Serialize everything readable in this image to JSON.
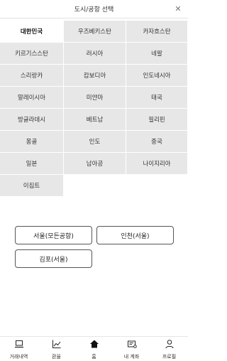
{
  "header": {
    "title": "도시/공항 선택",
    "close_glyph": "✕"
  },
  "countries": [
    {
      "label": "대한민국",
      "selected": true
    },
    {
      "label": "우즈베키스탄",
      "selected": false
    },
    {
      "label": "카자흐스탄",
      "selected": false
    },
    {
      "label": "키르기스스탄",
      "selected": false
    },
    {
      "label": "러시아",
      "selected": false
    },
    {
      "label": "네팔",
      "selected": false
    },
    {
      "label": "스리랑카",
      "selected": false
    },
    {
      "label": "캄보디아",
      "selected": false
    },
    {
      "label": "인도네시아",
      "selected": false
    },
    {
      "label": "말레이시아",
      "selected": false
    },
    {
      "label": "미얀마",
      "selected": false
    },
    {
      "label": "태국",
      "selected": false
    },
    {
      "label": "방글라데시",
      "selected": false
    },
    {
      "label": "베트남",
      "selected": false
    },
    {
      "label": "필리핀",
      "selected": false
    },
    {
      "label": "몽골",
      "selected": false
    },
    {
      "label": "인도",
      "selected": false
    },
    {
      "label": "중국",
      "selected": false
    },
    {
      "label": "일본",
      "selected": false
    },
    {
      "label": "남아공",
      "selected": false
    },
    {
      "label": "나이지리아",
      "selected": false
    },
    {
      "label": "이집트",
      "selected": false
    }
  ],
  "cities": [
    {
      "label": "서울(모든공항)"
    },
    {
      "label": "인천(서울)"
    },
    {
      "label": "김포(서울)"
    }
  ],
  "tabbar": [
    {
      "label": "거래내역",
      "icon": "laptop-icon"
    },
    {
      "label": "환율",
      "icon": "chart-icon"
    },
    {
      "label": "홈",
      "icon": "home-icon"
    },
    {
      "label": "내 계좌",
      "icon": "account-icon"
    },
    {
      "label": "프로필",
      "icon": "person-icon"
    }
  ],
  "colors": {
    "cell_bg": "#e7e7e7",
    "selected_bg": "#ffffff",
    "border": "#555555"
  }
}
